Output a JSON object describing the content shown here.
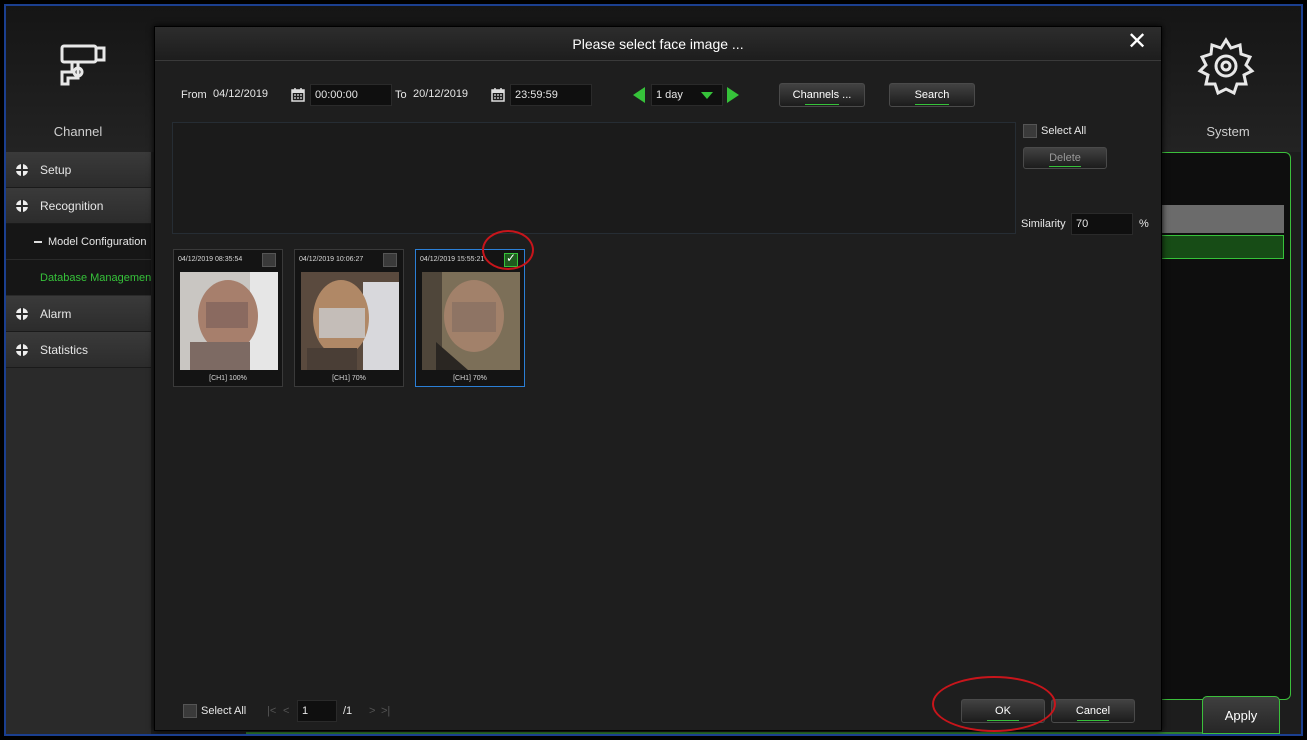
{
  "background": {
    "tabs": [
      {
        "label": "Channel",
        "icon": "camera-icon"
      },
      {
        "label": "System",
        "icon": "gear-icon"
      }
    ],
    "sidebar": [
      {
        "type": "item",
        "label": "Setup"
      },
      {
        "type": "item",
        "label": "Recognition"
      },
      {
        "type": "sub",
        "label": "Model Configuration"
      },
      {
        "type": "sub",
        "label": "Database Management",
        "active": true
      },
      {
        "type": "item",
        "label": "Alarm"
      },
      {
        "type": "item",
        "label": "Statistics"
      }
    ],
    "apply_label": "Apply"
  },
  "modal": {
    "title": "Please select face image ...",
    "filter": {
      "from_label": "From",
      "from_date": "04/12/2019",
      "from_time": "00:00:00",
      "to_label": "To",
      "to_date": "20/12/2019",
      "to_time": "23:59:59",
      "period": "1 day",
      "channels_label": "Channels ...",
      "search_label": "Search"
    },
    "side": {
      "select_all_label": "Select All",
      "delete_label": "Delete",
      "similarity_label": "Similarity",
      "similarity_value": "70",
      "similarity_unit": "%"
    },
    "faces": [
      {
        "timestamp": "04/12/2019 08:35:54",
        "caption": "[CH1] 100%",
        "checked": false
      },
      {
        "timestamp": "04/12/2019 10:06:27",
        "caption": "[CH1] 70%",
        "checked": false
      },
      {
        "timestamp": "04/12/2019 15:55:21",
        "caption": "[CH1] 70%",
        "checked": true
      }
    ],
    "pager": {
      "select_all_label": "Select All",
      "first": "|<",
      "prev": "<",
      "page": "1",
      "total": "/1",
      "next": ">",
      "last": ">|"
    },
    "ok_label": "OK",
    "cancel_label": "Cancel"
  },
  "colors": {
    "accent": "#36c23a",
    "annotation": "#c8151b",
    "selected_border": "#2b7fd6"
  }
}
